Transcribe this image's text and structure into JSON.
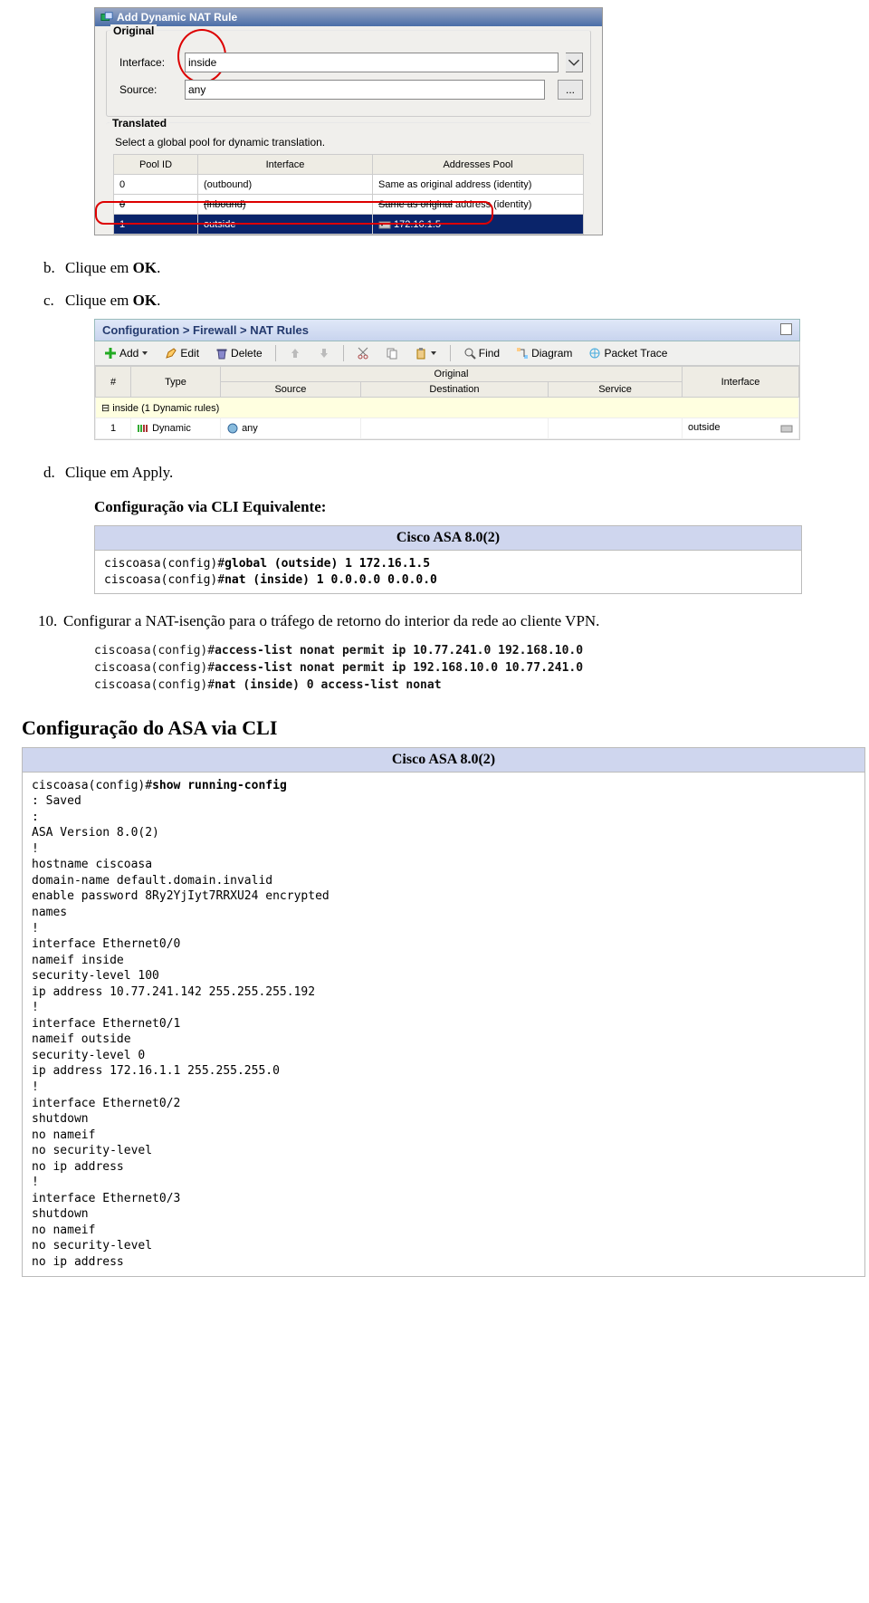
{
  "shot1": {
    "title": "Add Dynamic NAT Rule",
    "original_legend": "Original",
    "interface_label": "Interface:",
    "interface_value": "inside",
    "source_label": "Source:",
    "source_value": "any",
    "translated_legend": "Translated",
    "translated_desc": "Select a global pool for dynamic translation.",
    "cols": {
      "pool": "Pool ID",
      "interface": "Interface",
      "addresses": "Addresses Pool"
    },
    "rows": [
      {
        "id": "0",
        "iface": "(outbound)",
        "addr": "Same as original address (identity)"
      },
      {
        "id": "0",
        "iface": "(inbound)",
        "addr": "Same as original address (identity)"
      },
      {
        "id": "1",
        "iface": "outside",
        "addr": "172.16.1.5"
      }
    ]
  },
  "steps": {
    "b": "Clique em OK.",
    "c": "Clique em OK.",
    "d": "Clique em Apply.",
    "cli_equiv_heading": "Configuração via CLI Equivalente:",
    "n10": "Configurar a NAT-isenção para o tráfego de retorno do interior da rede ao cliente VPN."
  },
  "shot2": {
    "breadcrumb": "Configuration > Firewall > NAT Rules",
    "toolbar": {
      "add": "Add",
      "edit": "Edit",
      "delete": "Delete",
      "find": "Find",
      "diagram": "Diagram",
      "packet": "Packet Trace"
    },
    "cols": {
      "num": "#",
      "type": "Type",
      "original": "Original",
      "source": "Source",
      "destination": "Destination",
      "service": "Service",
      "interface": "Interface"
    },
    "group": "inside (1 Dynamic rules)",
    "row": {
      "num": "1",
      "type": "Dynamic",
      "source": "any",
      "dest": "",
      "service": "",
      "iface": "outside"
    }
  },
  "cli1": {
    "title": "Cisco ASA 8.0(2)",
    "line1a": "ciscoasa(config)#",
    "line1b": "global (outside) 1 172.16.1.5",
    "line2a": "ciscoasa(config)#",
    "line2b": "nat (inside) 1 0.0.0.0 0.0.0.0"
  },
  "cli_block": "ciscoasa(config)#access-list nonat permit ip 10.77.241.0 192.168.10.0\nciscoasa(config)#access-list nonat permit ip 192.168.10.0 10.77.241.0\nciscoasa(config)#nat (inside) 0 access-list nonat",
  "cli_block_display": {
    "l1p": "ciscoasa(config)#",
    "l1b": "access-list nonat permit ip 10.77.241.0 192.168.10.0",
    "l2p": "ciscoasa(config)#",
    "l2b": "access-list nonat permit ip 192.168.10.0 10.77.241.0",
    "l3p": "ciscoasa(config)#",
    "l3b": "nat (inside) 0 access-list nonat"
  },
  "section_heading": "Configuração do ASA via CLI",
  "cli2": {
    "title": "Cisco ASA 8.0(2)",
    "prefix": "ciscoasa(config)#",
    "cmd": "show running-config",
    "body": ": Saved\n:\nASA Version 8.0(2)\n!\nhostname ciscoasa\ndomain-name default.domain.invalid\nenable password 8Ry2YjIyt7RRXU24 encrypted\nnames\n!\ninterface Ethernet0/0\nnameif inside\nsecurity-level 100\nip address 10.77.241.142 255.255.255.192\n!\ninterface Ethernet0/1\nnameif outside\nsecurity-level 0\nip address 172.16.1.1 255.255.255.0\n!\ninterface Ethernet0/2\nshutdown\nno nameif\nno security-level\nno ip address\n!\ninterface Ethernet0/3\nshutdown\nno nameif\nno security-level\nno ip address"
  }
}
